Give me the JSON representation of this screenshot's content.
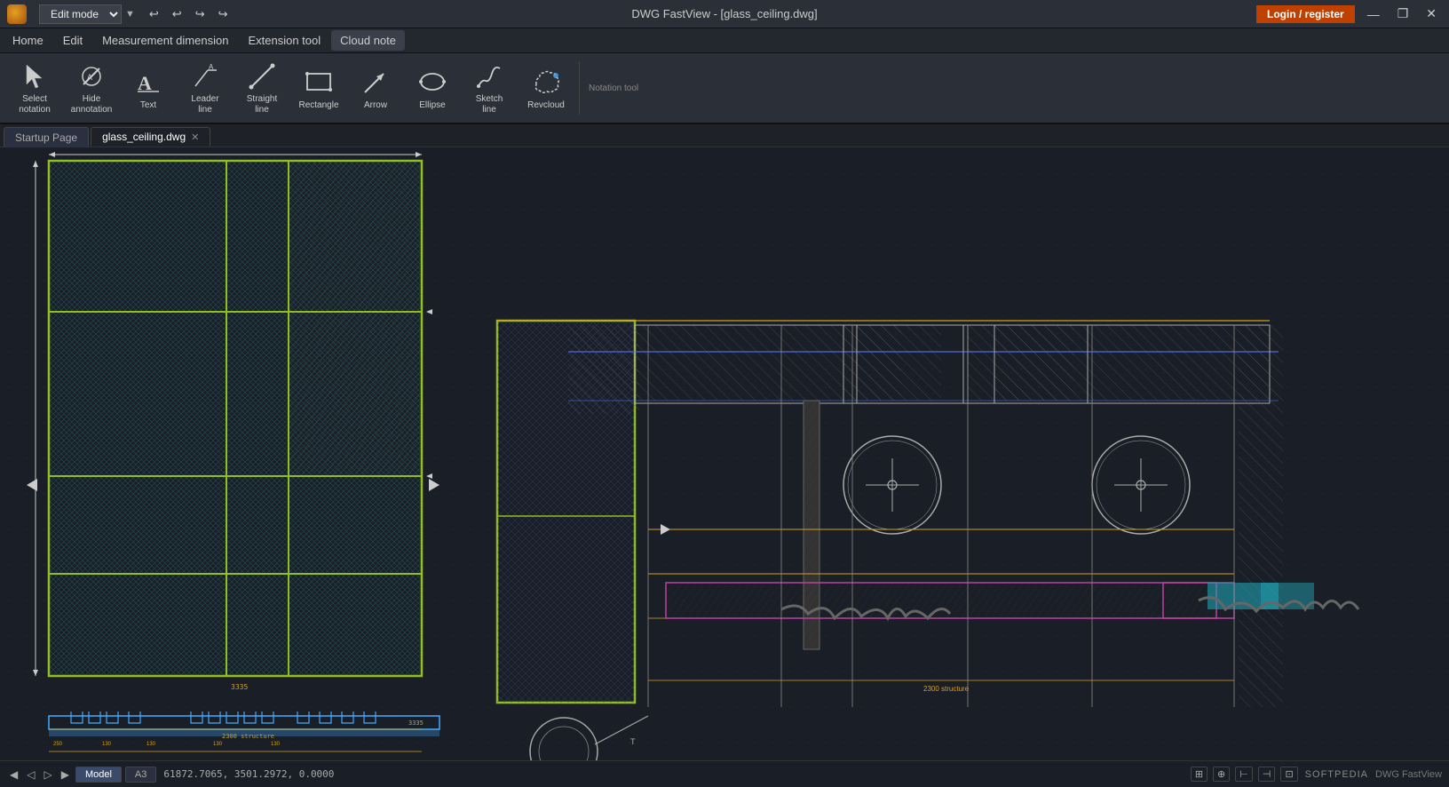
{
  "app": {
    "title": "DWG FastView - [glass_ceiling.dwg]",
    "icon_label": "DWG FastView app icon",
    "mode": "Edit mode",
    "login_label": "Login / register"
  },
  "menu": {
    "items": [
      "Home",
      "Edit",
      "Measurement dimension",
      "Extension tool",
      "Cloud note"
    ]
  },
  "toolbar": {
    "section_label": "Notation tool",
    "tools": [
      {
        "id": "select-notation",
        "label": "Select\nnotation",
        "icon": "cursor"
      },
      {
        "id": "hide-annotation",
        "label": "Hide\nannotation",
        "icon": "hide"
      },
      {
        "id": "text",
        "label": "Text",
        "icon": "text"
      },
      {
        "id": "leader-line",
        "label": "Leader\nline",
        "icon": "leader"
      },
      {
        "id": "straight-line",
        "label": "Straight\nline",
        "icon": "straight"
      },
      {
        "id": "rectangle",
        "label": "Rectangle",
        "icon": "rect"
      },
      {
        "id": "arrow",
        "label": "Arrow",
        "icon": "arrow"
      },
      {
        "id": "ellipse",
        "label": "Ellipse",
        "icon": "ellipse"
      },
      {
        "id": "sketch-line",
        "label": "Sketch\nline",
        "icon": "sketch"
      },
      {
        "id": "revcloud",
        "label": "Revcloud",
        "icon": "revcloud"
      }
    ]
  },
  "tabs": {
    "items": [
      {
        "id": "startup",
        "label": "Startup Page",
        "closeable": false
      },
      {
        "id": "glass-ceiling",
        "label": "glass_ceiling.dwg",
        "closeable": true,
        "active": true
      }
    ]
  },
  "status": {
    "coords": "61872.7065, 3501.2972, 0.0000",
    "bottom_tabs": [
      {
        "id": "model",
        "label": "Model",
        "active": true
      },
      {
        "id": "a3",
        "label": "A3",
        "active": false
      }
    ],
    "softpedia_label": "SOFTPEDIA",
    "fastview_label": "DWG FastView"
  },
  "window_controls": {
    "minimize": "—",
    "restore": "❐",
    "close": "✕"
  }
}
